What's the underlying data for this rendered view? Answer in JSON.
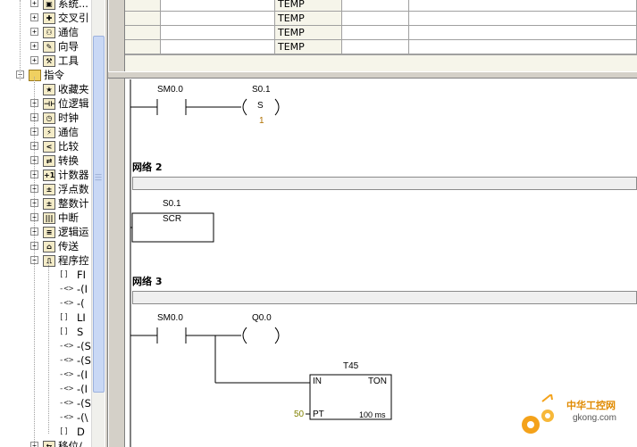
{
  "tree": {
    "items": [
      {
        "label": "系统...",
        "icon": "system-block-icon",
        "glyph": "▣",
        "expand": "+",
        "level": 2
      },
      {
        "label": "交叉引",
        "icon": "cross-reference-icon",
        "glyph": "✚",
        "expand": "+",
        "level": 2
      },
      {
        "label": "通信",
        "icon": "communication-icon",
        "glyph": "⚇",
        "expand": "+",
        "level": 2
      },
      {
        "label": "向导",
        "icon": "wizard-icon",
        "glyph": "✎",
        "expand": "+",
        "level": 2
      },
      {
        "label": "工具",
        "icon": "tools-icon",
        "glyph": "⚒",
        "expand": "+",
        "level": 2
      },
      {
        "label": "指令",
        "icon": "instructions-folder-icon",
        "glyph": "",
        "expand": "−",
        "level": 1
      },
      {
        "label": "收藏夹",
        "icon": "favorites-icon",
        "glyph": "★",
        "expand": "",
        "level": 2
      },
      {
        "label": "位逻辑",
        "icon": "bit-logic-icon",
        "glyph": "⊣⊢",
        "expand": "+",
        "level": 2
      },
      {
        "label": "时钟",
        "icon": "clock-icon",
        "glyph": "◷",
        "expand": "+",
        "level": 2
      },
      {
        "label": "通信",
        "icon": "communication-icon",
        "glyph": "⚡",
        "expand": "+",
        "level": 2
      },
      {
        "label": "比较",
        "icon": "compare-icon",
        "glyph": "<",
        "expand": "+",
        "level": 2
      },
      {
        "label": "转换",
        "icon": "convert-icon",
        "glyph": "⇄",
        "expand": "+",
        "level": 2
      },
      {
        "label": "计数器",
        "icon": "counter-icon",
        "glyph": "+1",
        "expand": "+",
        "level": 2
      },
      {
        "label": "浮点数",
        "icon": "float-math-icon",
        "glyph": "±",
        "expand": "+",
        "level": 2
      },
      {
        "label": "整数计",
        "icon": "integer-math-icon",
        "glyph": "±",
        "expand": "+",
        "level": 2
      },
      {
        "label": "中断",
        "icon": "interrupt-icon",
        "glyph": "|||",
        "expand": "+",
        "level": 2
      },
      {
        "label": "逻辑运",
        "icon": "logic-ops-icon",
        "glyph": "≡",
        "expand": "+",
        "level": 2
      },
      {
        "label": "传送",
        "icon": "move-icon",
        "glyph": "⌂",
        "expand": "+",
        "level": 2
      },
      {
        "label": "程序控",
        "icon": "program-control-icon",
        "glyph": "⎍",
        "expand": "−",
        "level": 2
      }
    ],
    "program_items": [
      {
        "label": "FI",
        "glyph": "[]"
      },
      {
        "label": "-(I",
        "glyph": "-<>"
      },
      {
        "label": "-(",
        "glyph": "-<>"
      },
      {
        "label": "LI",
        "glyph": "[]"
      },
      {
        "label": "S",
        "glyph": "[]"
      },
      {
        "label": "-(S",
        "glyph": "-<>"
      },
      {
        "label": "-(S",
        "glyph": "-<>"
      },
      {
        "label": "-(I",
        "glyph": "-<>"
      },
      {
        "label": "-(I",
        "glyph": "-<>"
      },
      {
        "label": "-(S",
        "glyph": "-<>"
      },
      {
        "label": "-(\\",
        "glyph": "-<>"
      },
      {
        "label": "D",
        "glyph": "[]"
      }
    ],
    "last_item": {
      "label": "移位/",
      "glyph": "⇆",
      "expand": "+"
    }
  },
  "table": {
    "rows": [
      {
        "type": "TEMP"
      },
      {
        "type": "TEMP"
      },
      {
        "type": "TEMP"
      },
      {
        "type": "TEMP"
      }
    ]
  },
  "ladder": {
    "network1": {
      "contact": "SM0.0",
      "coil_addr": "S0.1",
      "coil_type": "S",
      "coil_count": "1"
    },
    "network2": {
      "title": "网络 2",
      "box_addr": "S0.1",
      "box_type": "SCR"
    },
    "network3": {
      "title": "网络 3",
      "contact": "SM0.0",
      "coil_addr": "Q0.0",
      "timer_addr": "T45",
      "timer_type": "TON",
      "pin_in": "IN",
      "pin_pt": "PT",
      "pt_value": "50",
      "timebase": "100 ms"
    }
  },
  "colors": {
    "pt_value": "#808000",
    "coil_count": "#b07000",
    "watermark": "#e08a00"
  },
  "watermark": {
    "text": "中华工控网",
    "url": "gkong.com"
  }
}
